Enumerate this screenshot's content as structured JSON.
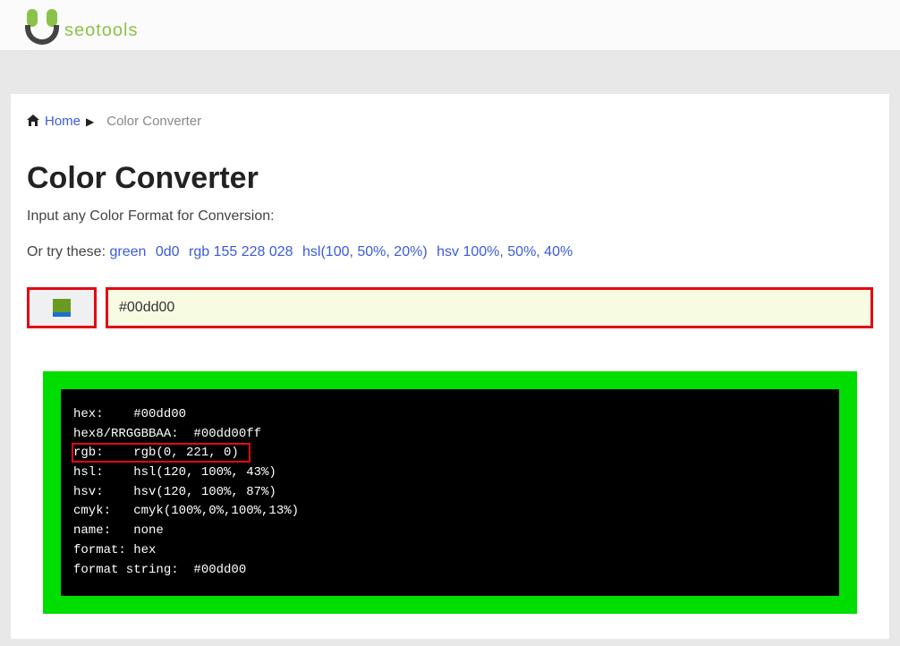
{
  "brand": {
    "text": "seotools"
  },
  "breadcrumb": {
    "home": "Home",
    "current": "Color Converter"
  },
  "title": "Color Converter",
  "subtitle": "Input any Color Format for Conversion:",
  "try_label": "Or try these:",
  "try_examples": [
    "green",
    "0d0",
    "rgb 155 228 028",
    "hsl(100, 50%, 20%)",
    "hsv 100%, 50%, 40%"
  ],
  "input": {
    "value": "#00dd00"
  },
  "result": {
    "lines": [
      "hex:    #00dd00",
      "hex8/RRGGBBAA:  #00dd00ff",
      "rgb:    rgb(0, 221, 0)",
      "hsl:    hsl(120, 100%, 43%)",
      "hsv:    hsv(120, 100%, 87%)",
      "cmyk:   cmyk(100%,0%,100%,13%)",
      "name:   none",
      "format: hex",
      "format string:  #00dd00"
    ]
  }
}
